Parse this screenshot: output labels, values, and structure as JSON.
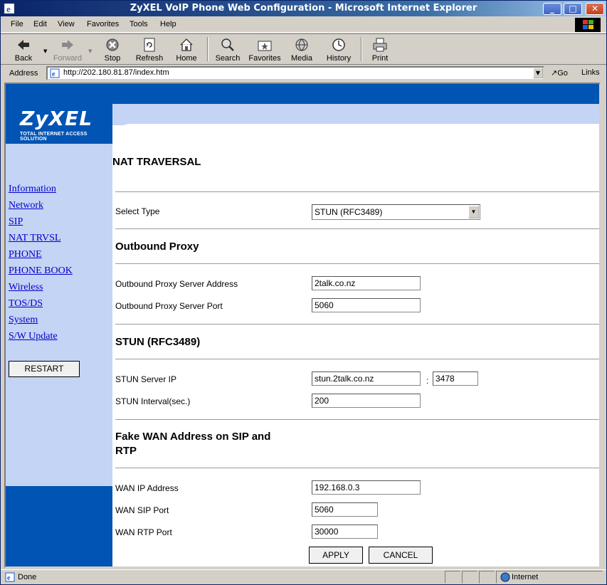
{
  "window": {
    "title": "ZyXEL VoIP Phone Web Configuration - Microsoft Internet Explorer",
    "min_label": "_",
    "max_label": "□",
    "close_label": "✕"
  },
  "menubar": {
    "items": [
      "File",
      "Edit",
      "View",
      "Favorites",
      "Tools",
      "Help"
    ]
  },
  "toolbar": {
    "back": "Back",
    "forward": "Forward",
    "stop": "Stop",
    "refresh": "Refresh",
    "home": "Home",
    "search": "Search",
    "favorites": "Favorites",
    "media": "Media",
    "history": "History",
    "print": "Print"
  },
  "addressbar": {
    "label": "Address",
    "url": "http://202.180.81.87/index.htm",
    "go": "Go",
    "links": "Links"
  },
  "sidebar": {
    "logo": "ZyXEL",
    "tagline": "TOTAL INTERNET ACCESS SOLUTION",
    "links": [
      "Information",
      "Network",
      "SIP",
      "NAT TRVSL",
      "PHONE",
      "PHONE BOOK",
      "Wireless",
      "TOS/DS",
      "System",
      "S/W Update"
    ],
    "restart": "RESTART"
  },
  "form": {
    "page_title": "NAT TRAVERSAL",
    "select_type_label": "Select Type",
    "select_type_value": "STUN (RFC3489)",
    "outbound": {
      "title": "Outbound Proxy",
      "address_label": "Outbound Proxy Server Address",
      "address_value": "2talk.co.nz",
      "port_label": "Outbound Proxy Server Port",
      "port_value": "5060"
    },
    "stun": {
      "title": "STUN (RFC3489)",
      "server_label": "STUN Server IP",
      "server_value": "stun.2talk.co.nz",
      "colon": ":",
      "server_port": "3478",
      "interval_label": "STUN Interval(sec.)",
      "interval_value": "200"
    },
    "fake_wan": {
      "title_line1": "Fake WAN Address on SIP and",
      "title_line2": "RTP",
      "ip_label": "WAN IP Address",
      "ip_value": "192.168.0.3",
      "sip_label": "WAN SIP Port",
      "sip_value": "5060",
      "rtp_label": "WAN RTP Port",
      "rtp_value": "30000"
    },
    "apply": "APPLY",
    "cancel": "CANCEL"
  },
  "statusbar": {
    "status": "Done",
    "zone": "Internet"
  }
}
